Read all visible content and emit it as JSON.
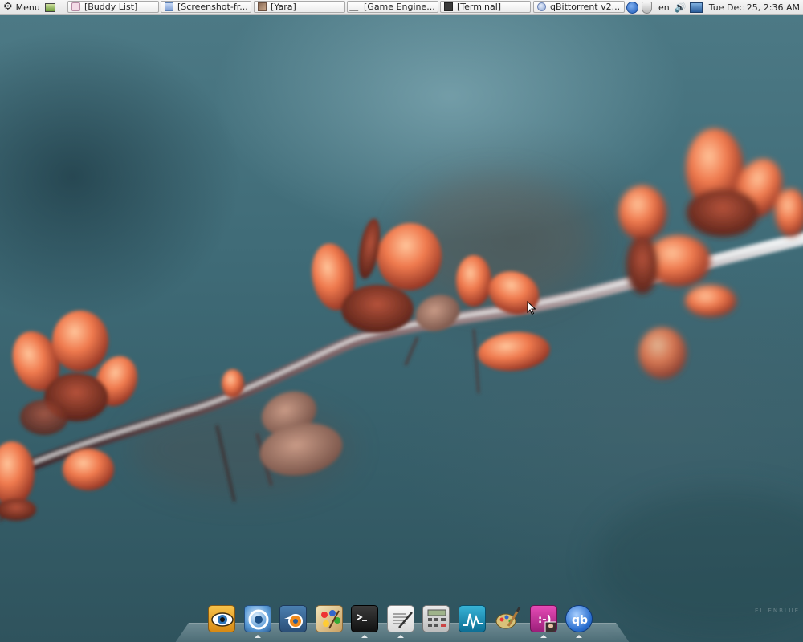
{
  "taskbar": {
    "menu_label": "Menu",
    "tasks": [
      {
        "label": "[Buddy List]",
        "icon": "buddy-list-icon"
      },
      {
        "label": "[Screenshot-fr...",
        "icon": "screenshot-icon"
      },
      {
        "label": "[Yara]",
        "icon": "yara-avatar-icon"
      },
      {
        "label": "[Game Engine...",
        "icon": "game-engine-icon"
      },
      {
        "label": "[Terminal]",
        "icon": "terminal-icon"
      },
      {
        "label": "qBittorrent v2...",
        "icon": "qbittorrent-icon"
      }
    ]
  },
  "tray": {
    "language": "en",
    "clock": "Tue Dec 25,  2:36 AM"
  },
  "wallpaper": {
    "credit": "EILENBLUE"
  },
  "dock": {
    "items": [
      {
        "name": "eye-app-launcher",
        "icon": "eye-icon"
      },
      {
        "name": "web-browser-launcher",
        "icon": "browser-icon",
        "running": true
      },
      {
        "name": "blender-launcher",
        "icon": "blender-icon"
      },
      {
        "name": "paint-palette-launcher",
        "icon": "palette-icon"
      },
      {
        "name": "terminal-launcher",
        "icon": "terminal-icon",
        "running": true
      },
      {
        "name": "text-editor-launcher",
        "icon": "text-editor-icon",
        "running": true
      },
      {
        "name": "calculator-launcher",
        "icon": "calculator-icon"
      },
      {
        "name": "system-monitor-launcher",
        "icon": "system-monitor-icon"
      },
      {
        "name": "gimp-launcher",
        "icon": "gimp-icon"
      },
      {
        "name": "chat-launcher",
        "icon": "chat-icon",
        "running": true
      },
      {
        "name": "qbittorrent-launcher",
        "icon": "qbittorrent-icon",
        "running": true
      }
    ]
  },
  "colors": {
    "panel_bg": "#ececec",
    "wallpaper_teal": "#3f6b77",
    "blossom": "#e8734c"
  }
}
